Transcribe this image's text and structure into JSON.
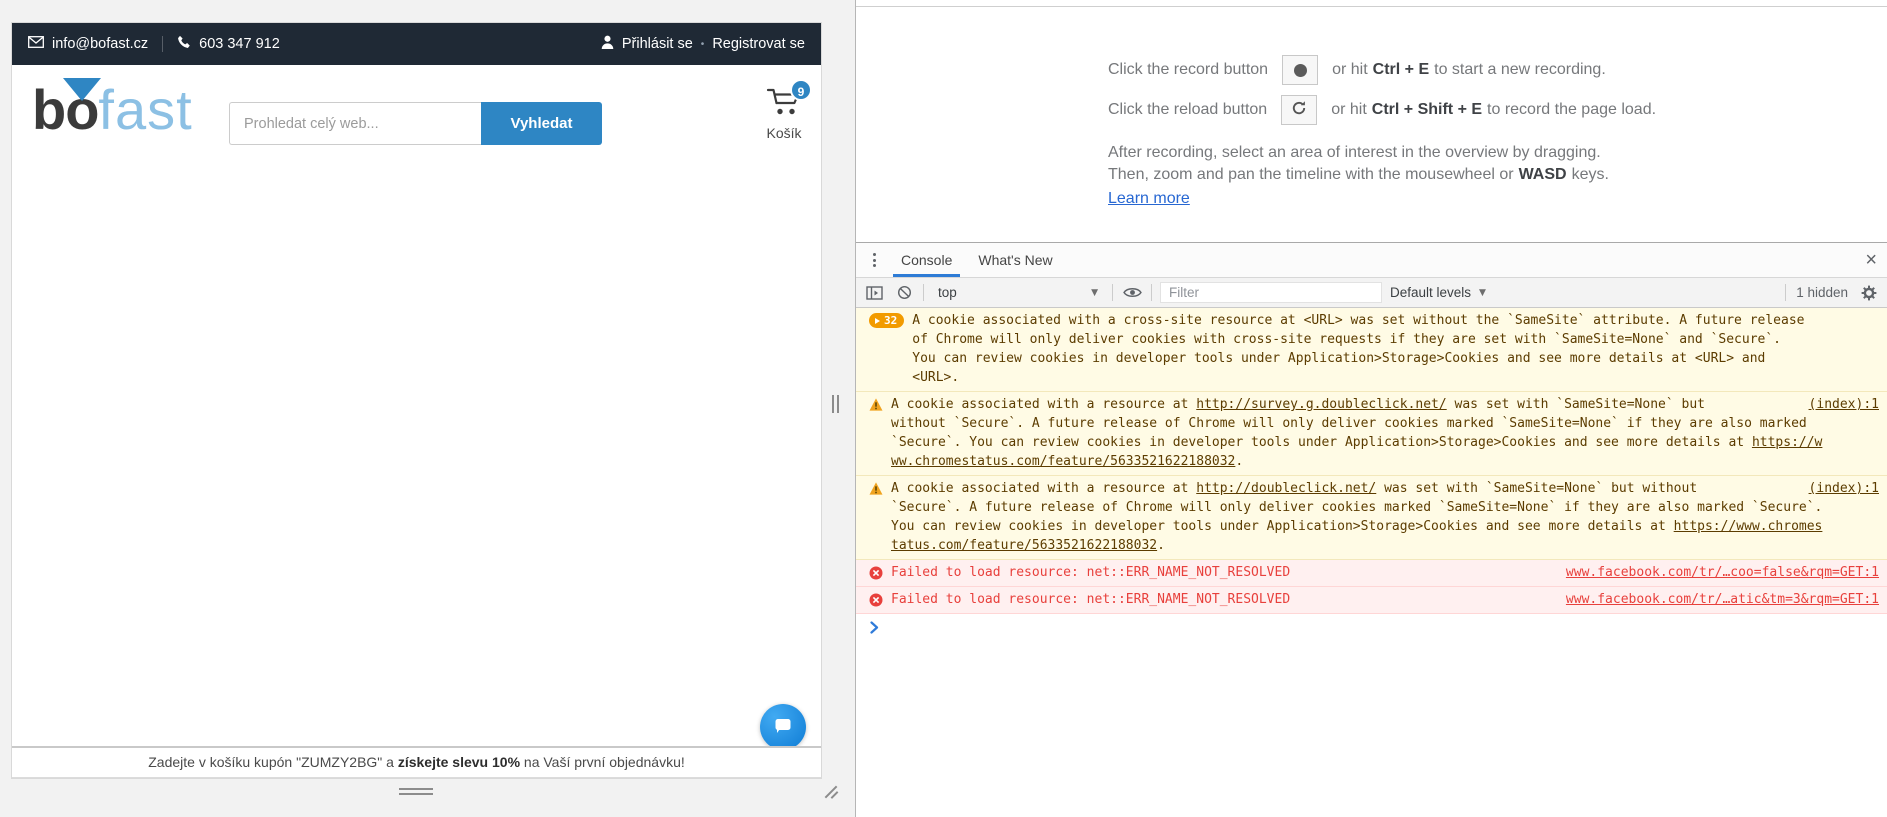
{
  "site": {
    "topbar": {
      "email": "info@bofast.cz",
      "phone": "603 347 912",
      "login": "Přihlásit se",
      "bullet": "•",
      "register": "Registrovat se"
    },
    "logo": {
      "bo": "bo",
      "fast": "fast"
    },
    "search": {
      "placeholder": "Prohledat celý web...",
      "button": "Vyhledat"
    },
    "cart": {
      "count": "9",
      "label": "Košík"
    },
    "coupon": {
      "pre": "Zadejte v košíku kupón \"ZUMZY2BG\" a ",
      "bold": "získejte slevu 10%",
      "post": " na Vaší první objednávku!"
    }
  },
  "devtools": {
    "perf": {
      "row1": {
        "pre": "Click the record button",
        "mid": "or hit",
        "key": "Ctrl + E",
        "post": "to start a new recording."
      },
      "row2": {
        "pre": "Click the reload button",
        "mid": "or hit",
        "key": "Ctrl + Shift + E",
        "post": "to record the page load."
      },
      "row3": "After recording, select an area of interest in the overview by dragging.",
      "row4": {
        "pre": "Then, zoom and pan the timeline with the mousewheel or",
        "key": "WASD",
        "post": "keys."
      },
      "learn_more": "Learn more"
    },
    "drawer": {
      "tabs": [
        "Console",
        "What's New"
      ],
      "close": "×",
      "toolbar": {
        "context": "top",
        "caret": "▼",
        "filter_placeholder": "Filter",
        "levels": "Default levels",
        "hidden": "1 hidden"
      }
    },
    "console": {
      "messages": [
        {
          "type": "warn-group",
          "count": "32",
          "segments": [
            {
              "t": "A cookie associated with a cross-site resource at <URL> was set without the `SameSite` attribute. A future release\nof Chrome will only deliver cookies with cross-site requests if they are set with `SameSite=None` and `Secure`.\nYou can review cookies in developer tools under Application>Storage>Cookies and see more details at <URL> and\n<URL>."
            }
          ],
          "source": ""
        },
        {
          "type": "warn",
          "segments": [
            {
              "t": "A cookie associated with a resource at "
            },
            {
              "t": "http://survey.g.doubleclick.net/",
              "link": true
            },
            {
              "t": " was set with `SameSite=None` but\nwithout `Secure`. A future release of Chrome will only deliver cookies marked `SameSite=None` if they are also marked\n`Secure`. You can review cookies in developer tools under Application>Storage>Cookies and see more details at "
            },
            {
              "t": "https://w\nww.chromestatus.com/feature/5633521622188032",
              "link": true
            },
            {
              "t": "."
            }
          ],
          "source": "(index):1"
        },
        {
          "type": "warn",
          "segments": [
            {
              "t": "A cookie associated with a resource at "
            },
            {
              "t": "http://doubleclick.net/",
              "link": true
            },
            {
              "t": " was set with `SameSite=None` but without\n`Secure`. A future release of Chrome will only deliver cookies marked `SameSite=None` if they are also marked `Secure`.\nYou can review cookies in developer tools under Application>Storage>Cookies and see more details at "
            },
            {
              "t": "https://www.chromes\ntatus.com/feature/5633521622188032",
              "link": true
            },
            {
              "t": "."
            }
          ],
          "source": "(index):1"
        },
        {
          "type": "error",
          "segments": [
            {
              "t": "Failed to load resource: net::ERR_NAME_NOT_RESOLVED"
            }
          ],
          "source": "www.facebook.com/tr/…coo=false&rqm=GET:1"
        },
        {
          "type": "error",
          "segments": [
            {
              "t": "Failed to load resource: net::ERR_NAME_NOT_RESOLVED"
            }
          ],
          "source": "www.facebook.com/tr/…atic&tm=3&rqm=GET:1"
        }
      ]
    }
  },
  "colors": {
    "accent_blue": "#2e86c4",
    "topbar_dark": "#1f2935",
    "warning_bg": "#fffbe5",
    "warning_text": "#5c3c00",
    "error_bg": "#fff0f0",
    "error_text": "#e8403c",
    "badge_orange": "#f29b00",
    "tab_underline": "#2e7cd6",
    "link_blue": "#2767d2"
  }
}
